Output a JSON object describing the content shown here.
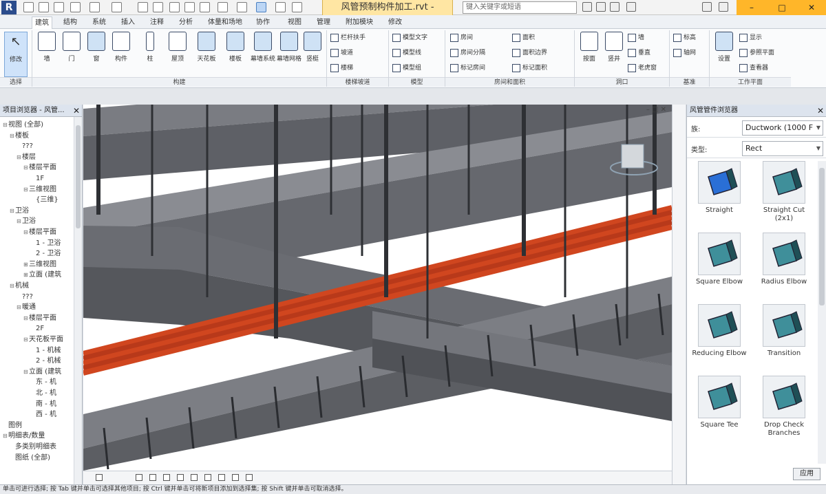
{
  "title_bar": {
    "app_logo": "R",
    "document_title": "风管预制构件加工.rvt -",
    "search_placeholder": "键入关键字或短语",
    "minimize": "–",
    "maximize": "□",
    "close": "✕"
  },
  "ribbon": {
    "tabs": [
      "建筑",
      "结构",
      "系统",
      "插入",
      "注释",
      "分析",
      "体量和场地",
      "协作",
      "视图",
      "管理",
      "附加模块",
      "修改"
    ],
    "modify_label": "修改",
    "buttons": [
      "墙",
      "门",
      "窗",
      "构件",
      "柱",
      "屋顶",
      "天花板",
      "楼板",
      "幕墙系统",
      "幕墙网格",
      "竖梃"
    ],
    "small_rows": {
      "railing": [
        "栏杆扶手",
        "坡道",
        "楼梯"
      ],
      "model": [
        "模型文字",
        "模型线",
        "模型组"
      ],
      "room": [
        "房间",
        "房间分隔",
        "标记房间"
      ],
      "area": [
        "面积",
        "面积边界",
        "标记面积"
      ],
      "opening": [
        "按面",
        "竖井",
        "墙",
        "垂直",
        "老虎窗"
      ],
      "datum": [
        "标高",
        "轴网"
      ],
      "workplane": [
        "设置",
        "显示",
        "参照平面",
        "查看器"
      ]
    },
    "panels": [
      "选择",
      "构建",
      "楼梯坡道",
      "模型",
      "房间和面积",
      "洞口",
      "基准",
      "工作平面"
    ]
  },
  "browser": {
    "title": "项目浏览器 - 风管...",
    "close": "✕",
    "items": [
      {
        "label": "视图 (全部)",
        "indent": 0,
        "tw": "⊟"
      },
      {
        "label": "楼板",
        "indent": 1,
        "tw": "⊟"
      },
      {
        "label": "???",
        "indent": 2,
        "tw": ""
      },
      {
        "label": "楼层",
        "indent": 2,
        "tw": "⊟"
      },
      {
        "label": "楼层平面",
        "indent": 3,
        "tw": "⊟"
      },
      {
        "label": "1F",
        "indent": 4,
        "tw": ""
      },
      {
        "label": "三维视图",
        "indent": 3,
        "tw": "⊟"
      },
      {
        "label": "{三维}",
        "indent": 4,
        "tw": ""
      },
      {
        "label": "卫浴",
        "indent": 1,
        "tw": "⊟"
      },
      {
        "label": "卫浴",
        "indent": 2,
        "tw": "⊟"
      },
      {
        "label": "楼层平面",
        "indent": 3,
        "tw": "⊟"
      },
      {
        "label": "1 - 卫浴",
        "indent": 4,
        "tw": ""
      },
      {
        "label": "2 - 卫浴",
        "indent": 4,
        "tw": ""
      },
      {
        "label": "三维视图",
        "indent": 3,
        "tw": "⊞"
      },
      {
        "label": "立面 (建筑",
        "indent": 3,
        "tw": "⊞"
      },
      {
        "label": "机械",
        "indent": 1,
        "tw": "⊟"
      },
      {
        "label": "???",
        "indent": 2,
        "tw": ""
      },
      {
        "label": "暖通",
        "indent": 2,
        "tw": "⊟"
      },
      {
        "label": "楼层平面",
        "indent": 3,
        "tw": "⊟"
      },
      {
        "label": "2F",
        "indent": 4,
        "tw": ""
      },
      {
        "label": "天花板平面",
        "indent": 3,
        "tw": "⊟"
      },
      {
        "label": "1 - 机械",
        "indent": 4,
        "tw": ""
      },
      {
        "label": "2 - 机械",
        "indent": 4,
        "tw": ""
      },
      {
        "label": "立面 (建筑",
        "indent": 3,
        "tw": "⊟"
      },
      {
        "label": "东 - 机",
        "indent": 4,
        "tw": ""
      },
      {
        "label": "北 - 机",
        "indent": 4,
        "tw": ""
      },
      {
        "label": "南 - 机",
        "indent": 4,
        "tw": ""
      },
      {
        "label": "西 - 机",
        "indent": 4,
        "tw": ""
      },
      {
        "label": "图例",
        "indent": 0,
        "tw": ""
      },
      {
        "label": "明细表/数量",
        "indent": 0,
        "tw": "⊟"
      },
      {
        "label": "多类别明细表",
        "indent": 1,
        "tw": ""
      },
      {
        "label": "图纸 (全部)",
        "indent": 1,
        "tw": ""
      }
    ]
  },
  "viewport": {
    "controls": "– □ ✕"
  },
  "properties": {
    "title": "风管管件浏览器",
    "close": "✕",
    "family_label": "族:",
    "family_value": "Ductwork (1000 F",
    "type_label": "类型:",
    "type_value": "Rect",
    "fittings": [
      "Straight",
      "Straight Cut (2x1)",
      "Square Elbow",
      "Radius Elbow",
      "Reducing Elbow",
      "Transition",
      "Square Tee",
      "Drop Check Branches"
    ],
    "apply_label": "应用"
  },
  "status_bar": {
    "text": "单击可进行选择; 按 Tab 键并单击可选择其他项目; 按 Ctrl 键并单击可将新项目添加到选择集; 按 Shift 键并单击可取消选择。"
  },
  "colors": {
    "duct": "#6e7076",
    "duct_dark": "#4f5156",
    "pipe": "#d0461f",
    "accent_title": "#ffe6a3",
    "window_ctrl": "#ffb629",
    "fitting_teal": "#3f8f9a"
  }
}
